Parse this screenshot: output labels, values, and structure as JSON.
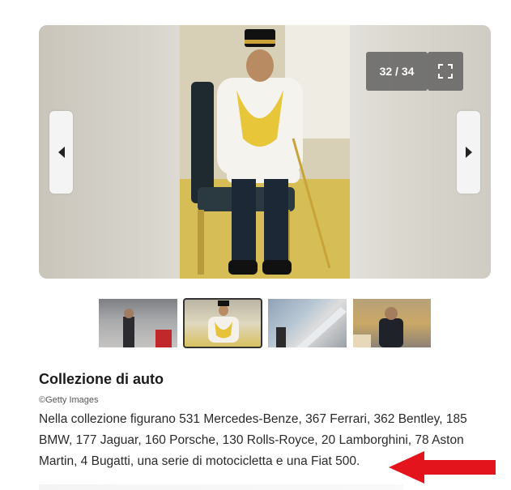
{
  "gallery": {
    "counter": "32 / 34",
    "icons": {
      "prev": "triangle-left-icon",
      "next": "triangle-right-icon",
      "fullscreen": "fullscreen-icon"
    }
  },
  "thumbnails": [
    {
      "name": "thumbnail-1"
    },
    {
      "name": "thumbnail-2",
      "active": true
    },
    {
      "name": "thumbnail-3"
    },
    {
      "name": "thumbnail-4"
    }
  ],
  "article": {
    "title": "Collezione di auto",
    "credit": "©Getty Images",
    "description": "Nella collezione figurano 531 Mercedes-Benze, 367 Ferrari, 362 Bentley, 185 BMW, 177 Jaguar, 160 Porsche, 130 Rolls-Royce, 20 Lamborghini, 78 Aston Martin, 4 Bugatti, una serie di motocicletta e una Fiat 500."
  },
  "annotation": {
    "arrow_color": "#e3141b"
  }
}
